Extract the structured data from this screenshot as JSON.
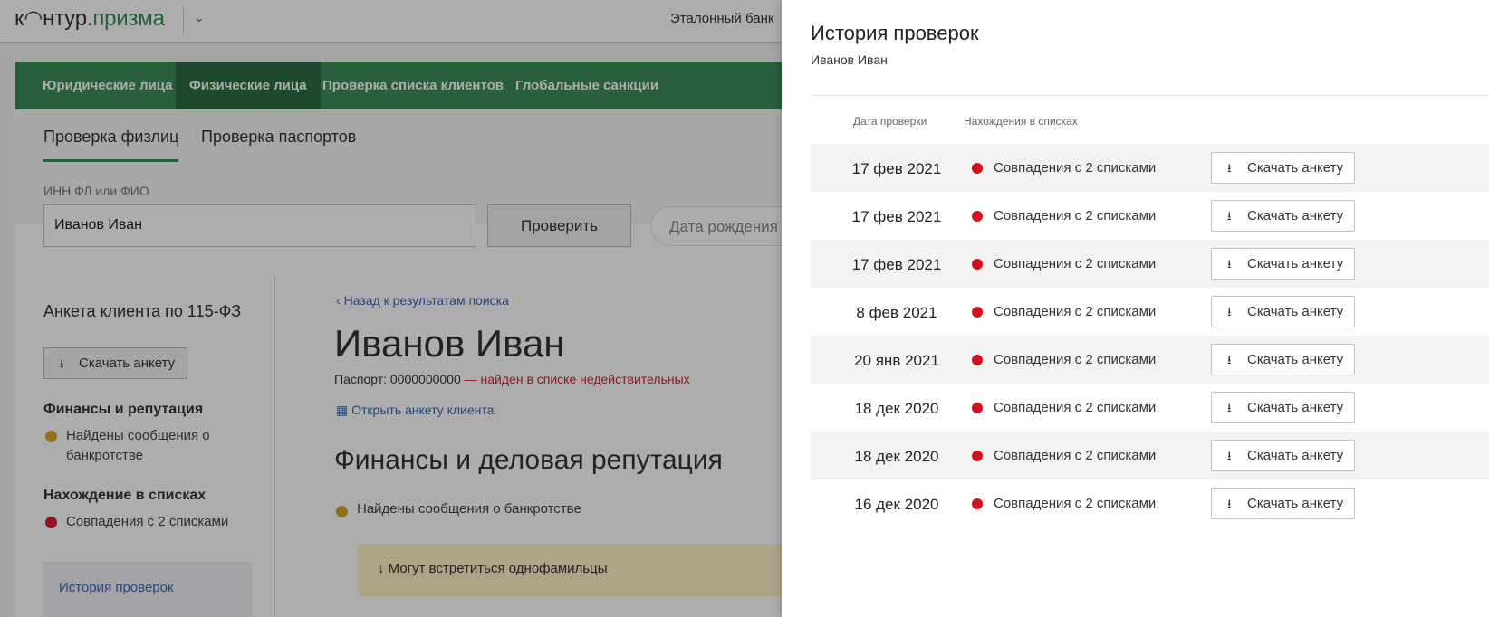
{
  "app": {
    "logo": {
      "part1": "к",
      "part2": "нтур",
      "dot": ".",
      "part3": "призма"
    },
    "bank": "Эталонный банк",
    "nav": [
      "Юридические лица",
      "Физические лица",
      "Проверка списка клиентов",
      "Глобальные санкции"
    ],
    "subtabs": [
      "Проверка физлиц",
      "Проверка паспортов"
    ],
    "search": {
      "label": "ИНН ФЛ или ФИО",
      "value": "Иванов Иван",
      "button": "Проверить",
      "dob_placeholder": "Дата рождения"
    },
    "left": {
      "title": "Анкета клиента по 115-ФЗ",
      "download": "Скачать анкету",
      "finance_h": "Финансы и репутация",
      "finance_item": "Найдены сообщения о банкротстве",
      "lists_h": "Нахождение в списках",
      "lists_item": "Совпадения с 2 списками",
      "history": "История проверок"
    },
    "content": {
      "back": "Назад к результатам поиска",
      "name": "Иванов Иван",
      "passport": "Паспорт: 0000000000",
      "passport_status": " — найден в списке недействительных",
      "open": "Открыть анкету клиента",
      "section": "Финансы и деловая репутация",
      "item": "Найдены сообщения о банкротстве",
      "warn": "Могут встретиться однофамильцы"
    }
  },
  "panel": {
    "title": "История проверок",
    "subtitle": "Иванов Иван",
    "col_date": "Дата проверки",
    "col_lists": "Нахождения в списках",
    "rows": [
      {
        "date": "17 фев 2021",
        "status": "Совпадения с 2 списками",
        "button": "Скачать анкету"
      },
      {
        "date": "17 фев 2021",
        "status": "Совпадения с 2 списками",
        "button": "Скачать анкету"
      },
      {
        "date": "17 фев 2021",
        "status": "Совпадения с 2 списками",
        "button": "Скачать анкету"
      },
      {
        "date": "8 фев 2021",
        "status": "Совпадения с 2 списками",
        "button": "Скачать анкету"
      },
      {
        "date": "20 янв 2021",
        "status": "Совпадения с 2 списками",
        "button": "Скачать анкету"
      },
      {
        "date": "18 дек 2020",
        "status": "Совпадения с 2 списками",
        "button": "Скачать анкету"
      },
      {
        "date": "18 дек 2020",
        "status": "Совпадения с 2 списками",
        "button": "Скачать анкету"
      },
      {
        "date": "16 дек 2020",
        "status": "Совпадения с 2 списками",
        "button": "Скачать анкету"
      }
    ]
  },
  "colors": {
    "brand_green": "#3f8c5a",
    "nav_active": "#2f6c43",
    "link_blue": "#3a67b8",
    "match_red": "#d4101d",
    "warn_yellow": "#fdf3c7"
  }
}
